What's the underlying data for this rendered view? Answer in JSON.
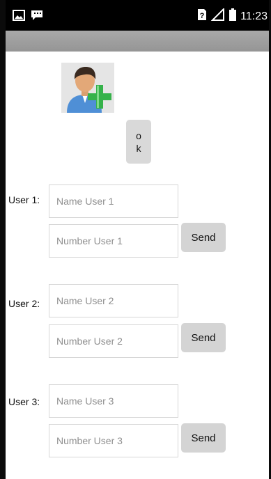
{
  "status_bar": {
    "time": "11:23",
    "icons": [
      "image-icon",
      "message-icon",
      "sim-question-icon",
      "signal-icon",
      "battery-icon"
    ]
  },
  "avatar": {
    "icon": "add-user-icon"
  },
  "ok_button": {
    "line1": "o",
    "line2": "k"
  },
  "users": [
    {
      "label": "User 1:",
      "name_placeholder": "Name User 1",
      "number_placeholder": "Number User 1",
      "send_label": "Send"
    },
    {
      "label": "User 2:",
      "name_placeholder": "Name User 2",
      "number_placeholder": "Number User 2",
      "send_label": "Send"
    },
    {
      "label": "User 3:",
      "name_placeholder": "Name User 3",
      "number_placeholder": "Number User 3",
      "send_label": "Send"
    }
  ],
  "colors": {
    "statusbar": "#000000",
    "titlebar": "#a0a0a0",
    "button": "#d6d6d6",
    "plus_green": "#35b24a"
  }
}
